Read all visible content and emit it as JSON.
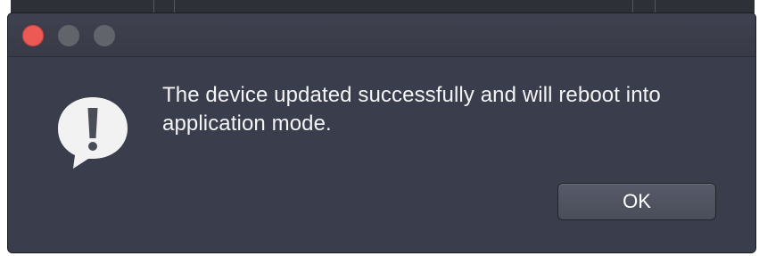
{
  "dialog": {
    "window_controls": {
      "close_color": "#ed5a55",
      "minimize_color": "#62646c",
      "zoom_color": "#62646c"
    },
    "icon": "alert-speech-bubble-icon",
    "message": "The device updated successfully and will reboot into application mode.",
    "ok_label": "OK"
  },
  "colors": {
    "dialog_background": "#3a3d4b",
    "text": "#f4f4f6",
    "button": "#4f5260"
  }
}
